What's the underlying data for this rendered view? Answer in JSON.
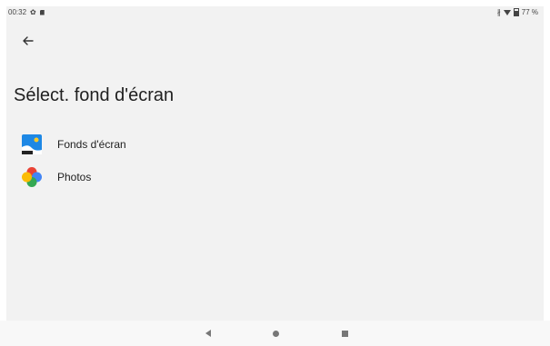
{
  "status_bar": {
    "time": "00:32",
    "battery": "77 %",
    "icons": [
      "settings-icon",
      "sd-card-icon",
      "bluetooth-icon",
      "wifi-icon",
      "battery-icon"
    ]
  },
  "header": {
    "back_icon": "arrow-left-icon",
    "title": "Sélect. fond d'écran"
  },
  "options": [
    {
      "label": "Fonds d'écran",
      "icon": "wallpapers-app-icon"
    },
    {
      "label": "Photos",
      "icon": "google-photos-icon"
    }
  ],
  "nav_bar": {
    "buttons": [
      "back-triangle-icon",
      "home-circle-icon",
      "recents-square-icon"
    ]
  },
  "colors": {
    "background": "#f2f2f2",
    "navbar": "#f8f8f8",
    "text": "#1f1f1f"
  }
}
